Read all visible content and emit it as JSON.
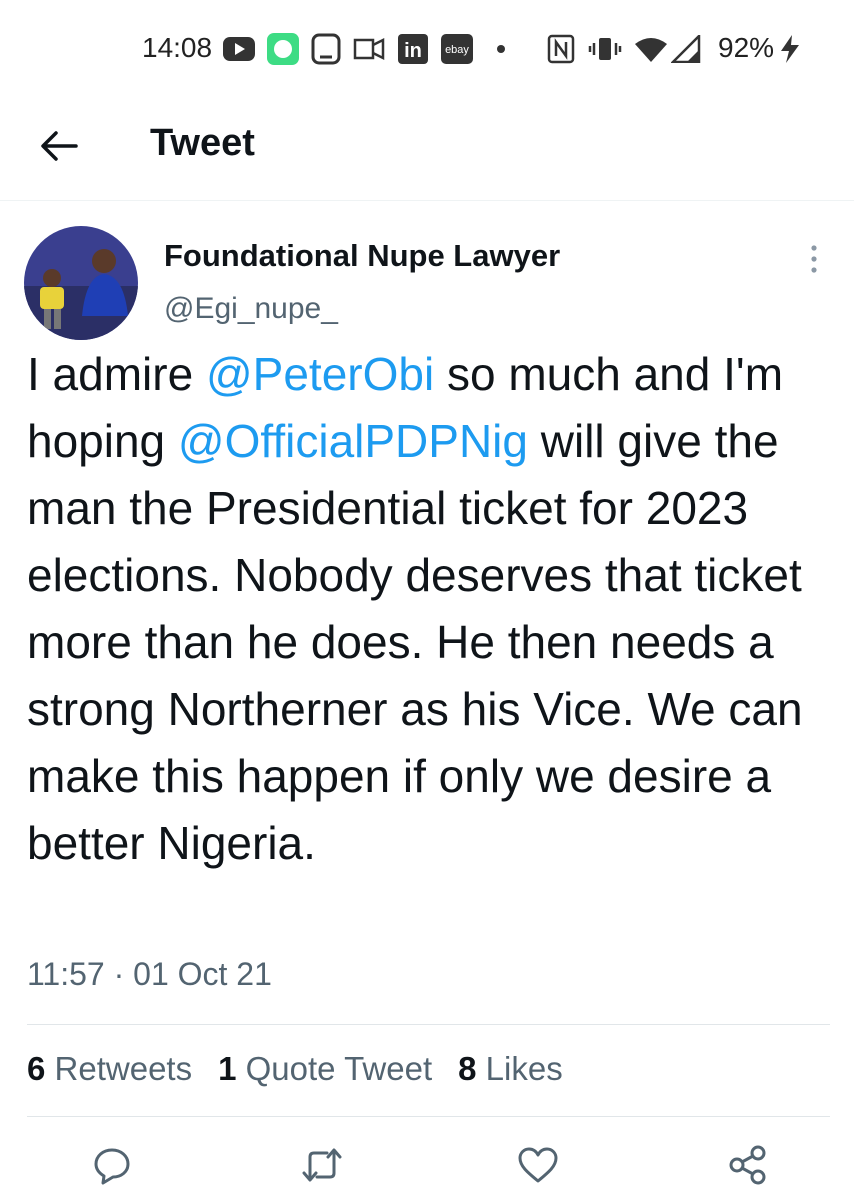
{
  "status_bar": {
    "time": "14:08",
    "battery": "92%",
    "app_icons": [
      "youtube-icon",
      "messages-icon",
      "tablet-icon",
      "media-icon",
      "linkedin-icon",
      "ebay-icon"
    ],
    "linkedin_label": "in",
    "ebay_label": "ebay"
  },
  "header": {
    "title": "Tweet"
  },
  "author": {
    "name": "Foundational Nupe Lawyer",
    "handle": "@Egi_nupe_"
  },
  "tweet": {
    "parts": [
      "I admire ",
      "@PeterObi",
      " so much and I'm hoping ",
      "@OfficialPDPNig",
      " will give the man the Presidential ticket for 2023 elections. Nobody deserves that ticket more than he does. He then needs a strong Northerner as his Vice. We can make this happen if only we desire a better Nigeria."
    ],
    "timestamp": "11:57 · 01 Oct 21"
  },
  "stats": {
    "retweets_count": "6",
    "retweets_label": "Retweets",
    "quotes_count": "1",
    "quotes_label": "Quote Tweet",
    "likes_count": "8",
    "likes_label": "Likes"
  },
  "colors": {
    "mention": "#1d9bf0",
    "muted": "#536471",
    "text": "#0f1419"
  }
}
